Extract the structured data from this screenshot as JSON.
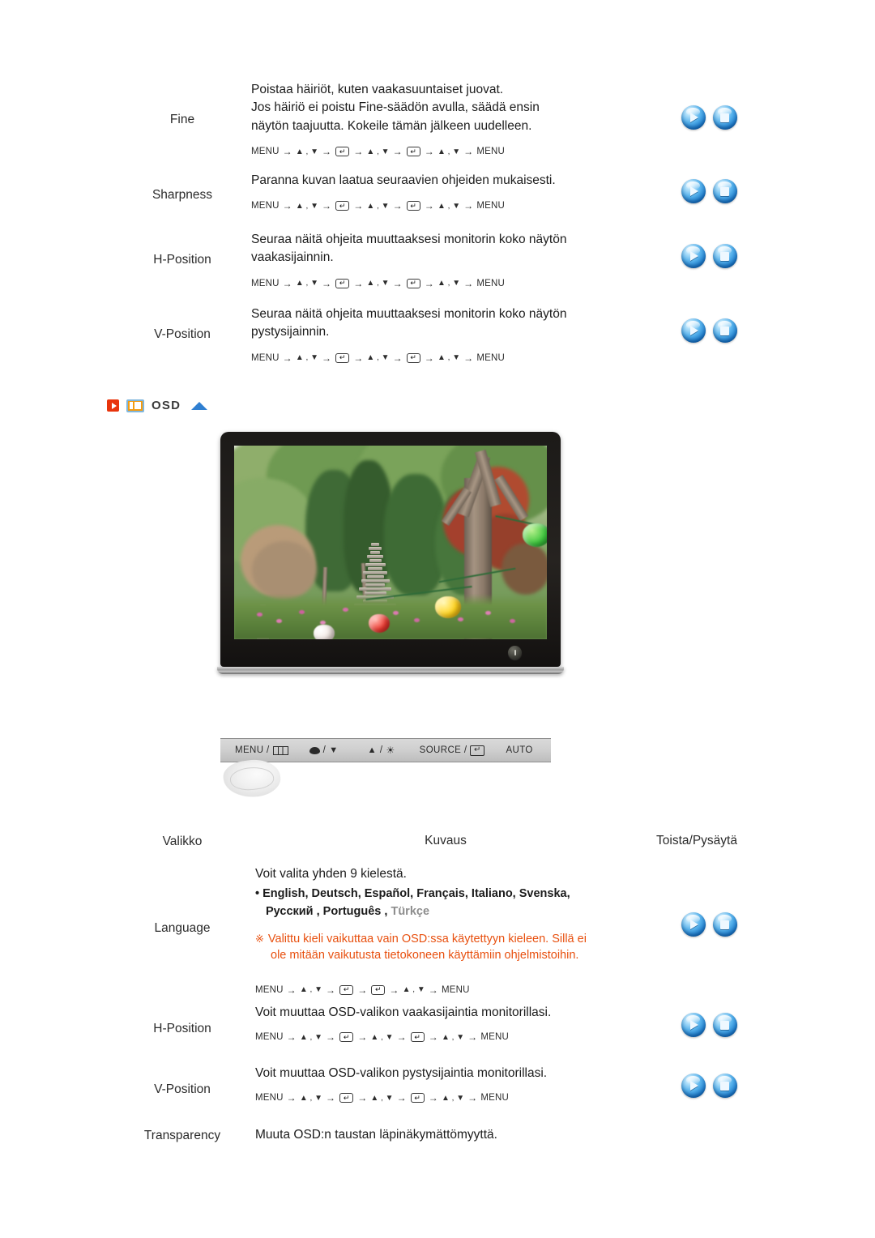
{
  "meta": {
    "accent_orange": "#e8500f",
    "accent_blue": "#2f7fd1",
    "icon_orange": "#f39c12",
    "red_tag": "#e8340c"
  },
  "top_rows": [
    {
      "menu": "Fine",
      "desc_lines": [
        "Poistaa häiriöt, kuten vaakasuuntaiset juovat.",
        "Jos häiriö ei poistu Fine-säädön avulla, säädä ensin",
        "näytön taajuutta. Kokeile tämän jälkeen uudelleen."
      ],
      "sequence": [
        "MENU",
        "→",
        "▲ , ▼",
        "→",
        "ENTER",
        "→",
        "▲ , ▼",
        "→",
        "ENTER",
        "→",
        "▲ , ▼",
        "→",
        "MENU"
      ],
      "controls": [
        "play",
        "stop"
      ]
    },
    {
      "menu": "Sharpness",
      "desc_lines": [
        "Paranna kuvan laatua seuraavien ohjeiden mukaisesti."
      ],
      "sequence": [
        "MENU",
        "→",
        "▲ , ▼",
        "→",
        "ENTER",
        "→",
        "▲ , ▼",
        "→",
        "ENTER",
        "→",
        "▲ , ▼",
        "→",
        "MENU"
      ],
      "controls": [
        "play",
        "stop"
      ]
    },
    {
      "menu": "H-Position",
      "desc_lines": [
        "Seuraa näitä ohjeita muuttaaksesi monitorin koko näytön",
        "vaakasijainnin."
      ],
      "sequence": [
        "MENU",
        "→",
        "▲ , ▼",
        "→",
        "ENTER",
        "→",
        "▲ , ▼",
        "→",
        "ENTER",
        "→",
        "▲ , ▼",
        "→",
        "MENU"
      ],
      "controls": [
        "play",
        "stop"
      ]
    },
    {
      "menu": "V-Position",
      "desc_lines": [
        "Seuraa näitä ohjeita muuttaaksesi monitorin koko näytön",
        "pystysijainnin."
      ],
      "sequence": [
        "MENU",
        "→",
        "▲ , ▼",
        "→",
        "ENTER",
        "→",
        "▲ , ▼",
        "→",
        "ENTER",
        "→",
        "▲ , ▼",
        "→",
        "MENU"
      ],
      "controls": [
        "play",
        "stop"
      ]
    }
  ],
  "section": {
    "title": "OSD",
    "icon": "osd-screen-icon",
    "left_tag_icon": "red-play-tag-icon",
    "collapse_icon": "blue-triangle-up-icon"
  },
  "monitor": {
    "alt": "monitor showing garden photo with stone pagodas and paper lanterns",
    "power_button": "power-button"
  },
  "control_bar": {
    "buttons": [
      {
        "label": "MENU /",
        "icon": "osd-menu-icon"
      },
      {
        "label": "/",
        "icon_left": "contrast-icon",
        "icon_right": "down-arrow-icon"
      },
      {
        "label": "/",
        "icon_left": "up-arrow-icon",
        "icon_right": "brightness-sun-icon"
      },
      {
        "label": "SOURCE /",
        "icon": "enter-icon"
      },
      {
        "label": "AUTO",
        "icon": ""
      }
    ],
    "hand_graphic": "hand-illustration"
  },
  "table_header": {
    "menu": "Valikko",
    "description": "Kuvaus",
    "play_stop": "Toista/Pysäytä"
  },
  "osd_rows": [
    {
      "menu": "Language",
      "desc_lines": [
        "Voit valita yhden 9 kielestä."
      ],
      "languages_line1": "English, Deutsch, Español, Français,  Italiano, Svenska,",
      "languages_line2_a": "Русский , Português",
      "languages_line2_sep": " , ",
      "languages_line2_b": "Türkçe",
      "warning_mark": "※",
      "warning_line1": "Valittu kieli vaikuttaa vain OSD:ssa käytettyyn kieleen. Sillä ei",
      "warning_line2": "ole mitään vaikutusta tietokoneen käyttämiin ohjelmistoihin.",
      "sequence": [
        "MENU",
        "→",
        "▲ , ▼",
        "→",
        "ENTER",
        "→",
        "ENTER",
        "→",
        "▲ , ▼",
        "→",
        "MENU"
      ],
      "controls": [
        "play",
        "stop"
      ]
    },
    {
      "menu": "H-Position",
      "desc_lines": [
        "Voit muuttaa OSD-valikon vaakasijaintia monitorillasi."
      ],
      "sequence": [
        "MENU",
        "→",
        "▲ , ▼",
        "→",
        "ENTER",
        "→",
        "▲ , ▼",
        "→",
        "ENTER",
        "→",
        "▲ , ▼",
        "→",
        "MENU"
      ],
      "controls": [
        "play",
        "stop"
      ]
    },
    {
      "menu": "V-Position",
      "desc_lines": [
        "Voit muuttaa OSD-valikon pystysijaintia monitorillasi."
      ],
      "sequence": [
        "MENU",
        "→",
        "▲ , ▼",
        "→",
        "ENTER",
        "→",
        "▲ , ▼",
        "→",
        "ENTER",
        "→",
        "▲ , ▼",
        "→",
        "MENU"
      ],
      "controls": [
        "play",
        "stop"
      ]
    },
    {
      "menu": "Transparency",
      "desc_lines": [
        "Muuta OSD:n taustan läpinäkymättömyyttä."
      ],
      "sequence": [],
      "controls": []
    }
  ]
}
